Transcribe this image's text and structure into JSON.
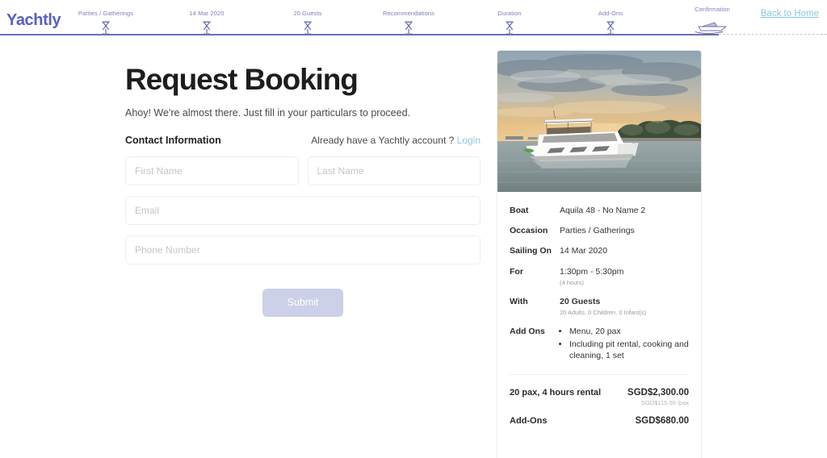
{
  "brand": {
    "name": "Yachtly",
    "color": "#5a5fc0"
  },
  "header": {
    "back_to_home": "Back to Home",
    "steps": [
      {
        "label": "Parties / Gatherings",
        "icon": "hourglass-icon",
        "state": "complete"
      },
      {
        "label": "14 Mar 2020",
        "icon": "hourglass-icon",
        "state": "complete"
      },
      {
        "label": "20 Guests",
        "icon": "hourglass-icon",
        "state": "complete"
      },
      {
        "label": "Recommendations",
        "icon": "hourglass-icon",
        "state": "complete"
      },
      {
        "label": "Duration",
        "icon": "hourglass-icon",
        "state": "complete"
      },
      {
        "label": "Add-Ons",
        "icon": "hourglass-icon",
        "state": "complete"
      },
      {
        "label": "Confirmation",
        "icon": "boat-icon",
        "state": "current"
      }
    ]
  },
  "form": {
    "title": "Request Booking",
    "subtitle": "Ahoy! We're almost there. Just fill in your particulars to proceed.",
    "contact_label": "Contact Information",
    "account_prompt": "Already have a Yachtly account ?",
    "login_label": "Login",
    "fields": {
      "first_name": {
        "placeholder": "First Name",
        "value": ""
      },
      "last_name": {
        "placeholder": "Last Name",
        "value": ""
      },
      "email": {
        "placeholder": "Email",
        "value": ""
      },
      "phone": {
        "placeholder": "Phone Number",
        "value": ""
      }
    },
    "submit_label": "Submit"
  },
  "summary": {
    "boat_label": "Boat",
    "boat_value": "Aquila 48 - No Name 2",
    "occasion_label": "Occasion",
    "occasion_value": "Parties / Gatherings",
    "sailing_label": "Sailing On",
    "sailing_value": "14 Mar 2020",
    "for_label": "For",
    "for_value": "1:30pm - 5:30pm",
    "for_sub": "(4 hours)",
    "with_label": "With",
    "with_value": "20 Guests",
    "with_sub": "20 Adults, 0 Children, 0 Infant(s)",
    "addons_label": "Add Ons",
    "addons": [
      "Menu, 20 pax",
      "Including pit rental, cooking and cleaning, 1 set"
    ],
    "rental_label": "20 pax, 4 hours rental",
    "rental_amount": "SGD$2,300.00",
    "rental_unit": "SGD$115.00 /pax",
    "addons_price_label": "Add-Ons",
    "addons_price_amount": "SGD$680.00"
  }
}
